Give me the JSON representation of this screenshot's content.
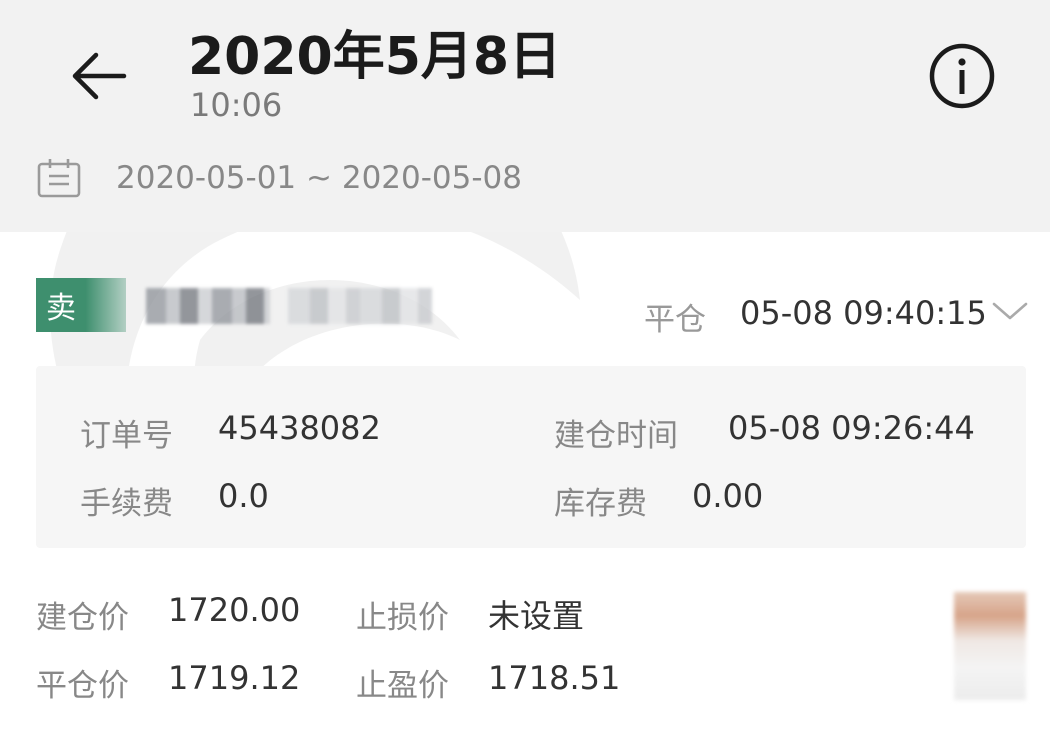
{
  "header": {
    "title": "2020年5月8日",
    "time": "10:06",
    "date_range": "2020-05-01 ~ 2020-05-08",
    "icons": {
      "back": "back-arrow-icon",
      "info": "info-icon",
      "calendar": "calendar-icon"
    }
  },
  "order": {
    "side_label": "卖",
    "close_label": "平仓",
    "close_time": "05-08 09:40:15",
    "details": {
      "order_no_label": "订单号",
      "order_no": "45438082",
      "open_time_label": "建仓时间",
      "open_time": "05-08 09:26:44",
      "fee_label": "手续费",
      "fee": "0.0",
      "storage_fee_label": "库存费",
      "storage_fee": "0.00"
    },
    "prices": {
      "open_price_label": "建仓价",
      "open_price": "1720.00",
      "stop_loss_label": "止损价",
      "stop_loss": "未设置",
      "close_price_label": "平仓价",
      "close_price": "1719.12",
      "take_profit_label": "止盈价",
      "take_profit": "1718.51"
    }
  },
  "colors": {
    "sell_badge": "#3e8f6e",
    "header_bg": "#f2f2f2",
    "detail_bg": "#f6f6f6"
  }
}
